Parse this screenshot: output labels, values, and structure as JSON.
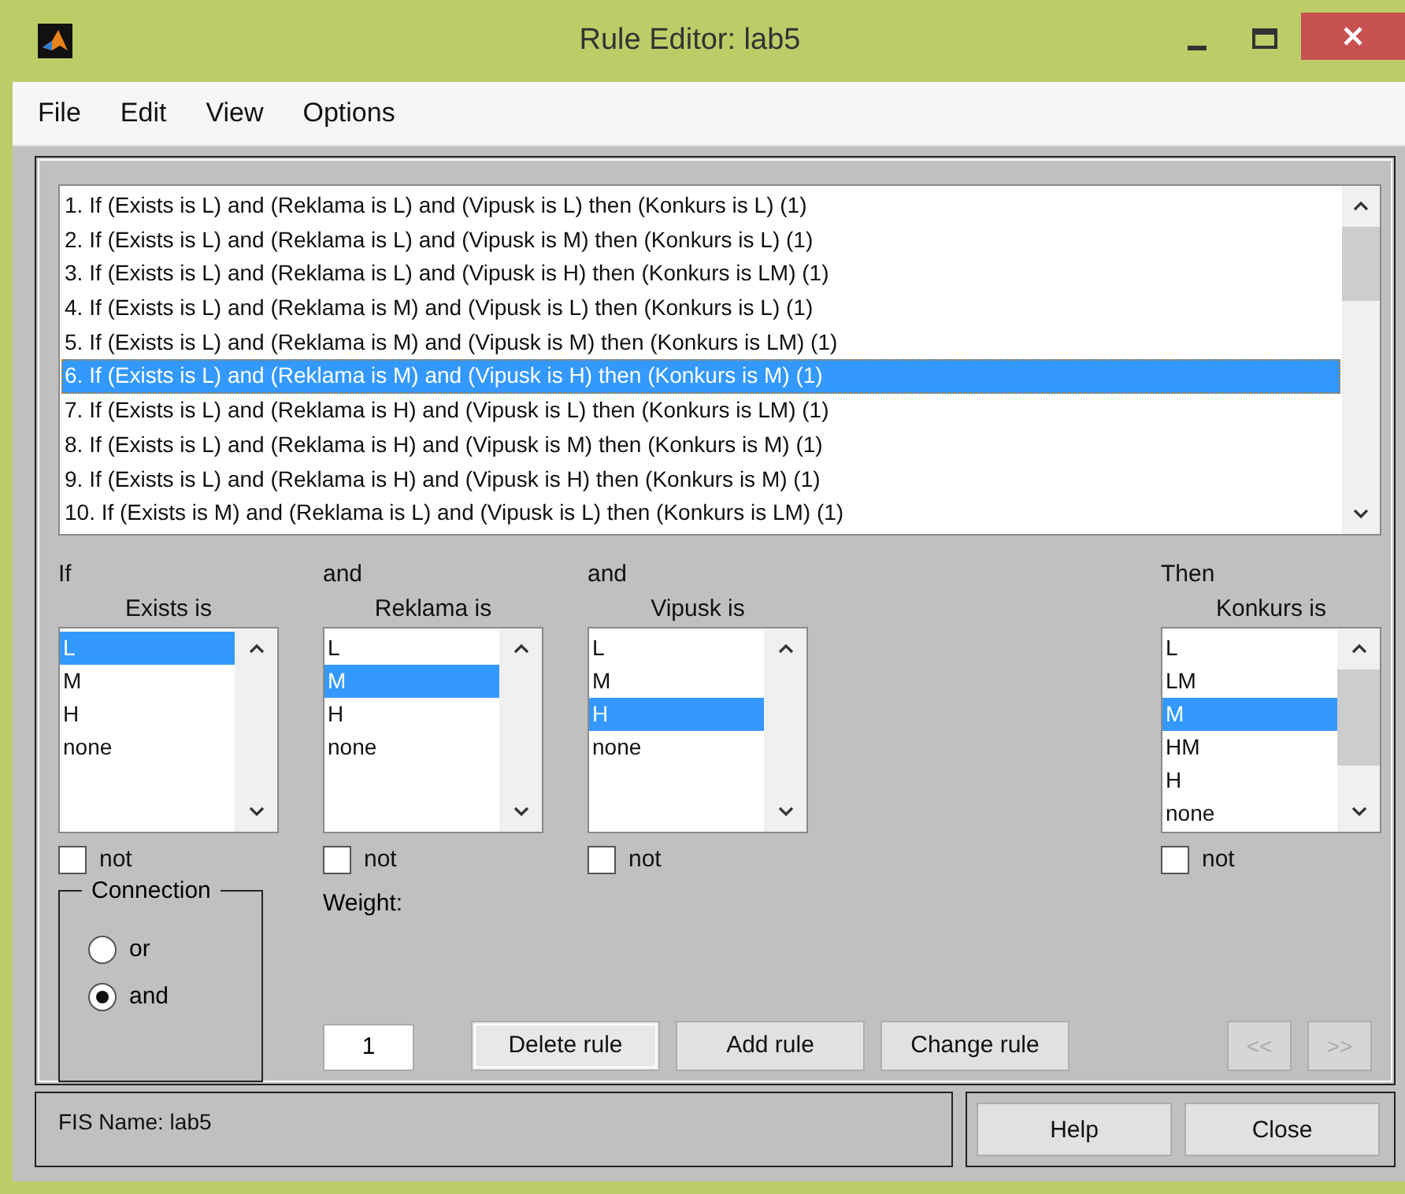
{
  "window": {
    "title": "Rule Editor: lab5"
  },
  "menu": [
    "File",
    "Edit",
    "View",
    "Options"
  ],
  "rules": [
    {
      "text": "1. If (Exists is L) and (Reklama is L) and (Vipusk is L) then (Konkurs is L) (1)",
      "selected": false
    },
    {
      "text": "2. If (Exists is L) and (Reklama is L) and (Vipusk is M) then (Konkurs is L) (1)",
      "selected": false
    },
    {
      "text": "3. If (Exists is L) and (Reklama is L) and (Vipusk is H) then (Konkurs is LM) (1)",
      "selected": false
    },
    {
      "text": "4. If (Exists is L) and (Reklama is M) and (Vipusk is L) then (Konkurs is L) (1)",
      "selected": false
    },
    {
      "text": "5. If (Exists is L) and (Reklama is M) and (Vipusk is M) then (Konkurs is LM) (1)",
      "selected": false
    },
    {
      "text": "6. If (Exists is L) and (Reklama is M) and (Vipusk is H) then (Konkurs is M) (1)",
      "selected": true
    },
    {
      "text": "7. If (Exists is L) and (Reklama is H) and (Vipusk is L) then (Konkurs is LM) (1)",
      "selected": false
    },
    {
      "text": "8. If (Exists is L) and (Reklama is H) and (Vipusk is M) then (Konkurs is M) (1)",
      "selected": false
    },
    {
      "text": "9. If (Exists is L) and (Reklama is H) and (Vipusk is H) then (Konkurs is M) (1)",
      "selected": false
    },
    {
      "text": "10. If (Exists is M) and (Reklama is L) and (Vipusk is L) then (Konkurs is LM) (1)",
      "selected": false
    }
  ],
  "variables": [
    {
      "kind": "input",
      "connector": "If",
      "label": "Exists is",
      "not_label": "not",
      "not_checked": false,
      "options": [
        {
          "label": "L",
          "selected": true
        },
        {
          "label": "M",
          "selected": false
        },
        {
          "label": "H",
          "selected": false
        },
        {
          "label": "none",
          "selected": false
        }
      ]
    },
    {
      "kind": "input",
      "connector": "and",
      "label": "Reklama is",
      "not_label": "not",
      "not_checked": false,
      "options": [
        {
          "label": "L",
          "selected": false
        },
        {
          "label": "M",
          "selected": true
        },
        {
          "label": "H",
          "selected": false
        },
        {
          "label": "none",
          "selected": false
        }
      ]
    },
    {
      "kind": "input",
      "connector": "and",
      "label": "Vipusk is",
      "not_label": "not",
      "not_checked": false,
      "options": [
        {
          "label": "L",
          "selected": false
        },
        {
          "label": "M",
          "selected": false
        },
        {
          "label": "H",
          "selected": true
        },
        {
          "label": "none",
          "selected": false
        }
      ]
    },
    {
      "kind": "output",
      "connector": "Then",
      "label": "Konkurs is",
      "not_label": "not",
      "not_checked": false,
      "options": [
        {
          "label": "L",
          "selected": false
        },
        {
          "label": "LM",
          "selected": false
        },
        {
          "label": "M",
          "selected": true
        },
        {
          "label": "HM",
          "selected": false
        },
        {
          "label": "H",
          "selected": false
        },
        {
          "label": "none",
          "selected": false
        }
      ]
    }
  ],
  "connection": {
    "title": "Connection",
    "options": [
      {
        "label": "or",
        "selected": false
      },
      {
        "label": "and",
        "selected": true
      }
    ]
  },
  "weight": {
    "label": "Weight:",
    "value": "1"
  },
  "rule_buttons": [
    {
      "label": "Delete rule",
      "disabled": false
    },
    {
      "label": "Add rule",
      "disabled": false
    },
    {
      "label": "Change rule",
      "disabled": false
    }
  ],
  "nav_buttons": [
    {
      "label": "<<",
      "disabled": true
    },
    {
      "label": ">>",
      "disabled": true
    }
  ],
  "status": "FIS Name: lab5",
  "footer_buttons": [
    "Help",
    "Close"
  ]
}
